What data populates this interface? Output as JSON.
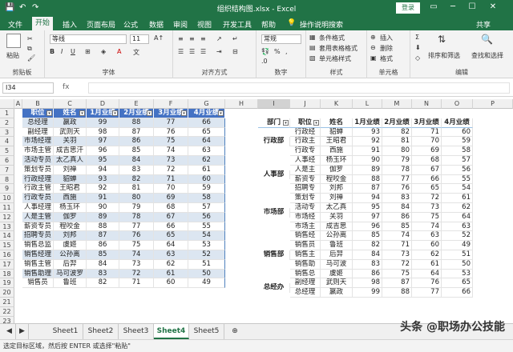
{
  "window": {
    "title": "组织结构图.xlsx - Excel",
    "login_label": "登录"
  },
  "menu": {
    "items": [
      "文件",
      "开始",
      "插入",
      "页面布局",
      "公式",
      "数据",
      "审阅",
      "视图",
      "开发工具",
      "帮助"
    ],
    "tell_me": "操作说明搜索",
    "share": "共享"
  },
  "ribbon": {
    "paste": "粘贴",
    "clipboard": "剪贴板",
    "font_name": "等线",
    "font_size": "11",
    "font": "字体",
    "alignment": "对齐方式",
    "number_format": "常规",
    "number": "数字",
    "cond_format": "条件格式",
    "table_format": "套用表格格式",
    "cell_style": "单元格样式",
    "styles": "样式",
    "insert": "插入",
    "delete": "删除",
    "format": "格式",
    "cells": "单元格",
    "sort_filter": "排序和筛选",
    "find_select": "查找和选择",
    "editing": "编辑"
  },
  "formula": {
    "cell_ref": "I34",
    "fx": "fx"
  },
  "columns": [
    "A",
    "B",
    "C",
    "D",
    "E",
    "F",
    "G",
    "H",
    "I",
    "J",
    "K",
    "L",
    "M",
    "N",
    "O",
    "P"
  ],
  "left_table": {
    "headers": [
      "职位",
      "姓名",
      "1月业绩",
      "2月业绩",
      "3月业绩",
      "4月业绩"
    ],
    "rows": [
      [
        "总经理",
        "嬴政",
        "99",
        "88",
        "77",
        "66"
      ],
      [
        "副经理",
        "武则天",
        "98",
        "87",
        "76",
        "65"
      ],
      [
        "市场经理",
        "关羽",
        "97",
        "86",
        "75",
        "64"
      ],
      [
        "市场主管",
        "成吉思汗",
        "96",
        "85",
        "74",
        "63"
      ],
      [
        "活动专员",
        "太乙真人",
        "95",
        "84",
        "73",
        "62"
      ],
      [
        "策划专员",
        "刘禅",
        "94",
        "83",
        "72",
        "61"
      ],
      [
        "行政经理",
        "貂蝉",
        "93",
        "82",
        "71",
        "60"
      ],
      [
        "行政主管",
        "王昭君",
        "92",
        "81",
        "70",
        "59"
      ],
      [
        "行政专员",
        "西施",
        "91",
        "80",
        "69",
        "58"
      ],
      [
        "人事经理",
        "杨玉环",
        "90",
        "79",
        "68",
        "57"
      ],
      [
        "人是主管",
        "伽罗",
        "89",
        "78",
        "67",
        "56"
      ],
      [
        "薪资专员",
        "程咬金",
        "88",
        "77",
        "66",
        "55"
      ],
      [
        "招聘专员",
        "刘邦",
        "87",
        "76",
        "65",
        "54"
      ],
      [
        "销售总监",
        "虞姬",
        "86",
        "75",
        "64",
        "53"
      ],
      [
        "销售经理",
        "公孙离",
        "85",
        "74",
        "63",
        "52"
      ],
      [
        "销售主管",
        "后羿",
        "84",
        "73",
        "62",
        "51"
      ],
      [
        "销售助理",
        "马可波罗",
        "83",
        "72",
        "61",
        "50"
      ],
      [
        "销售员",
        "鲁班",
        "82",
        "71",
        "60",
        "49"
      ]
    ]
  },
  "pivot": {
    "headers": [
      "部门",
      "职位",
      "姓名",
      "1月业绩",
      "2月业绩",
      "3月业绩",
      "4月业绩"
    ],
    "groups": [
      {
        "dept": "行政部",
        "rows": [
          [
            "行政经",
            "貂蝉",
            "93",
            "82",
            "71",
            "60"
          ],
          [
            "行政主",
            "王昭君",
            "92",
            "81",
            "70",
            "59"
          ],
          [
            "行政专",
            "西施",
            "91",
            "80",
            "69",
            "58"
          ]
        ]
      },
      {
        "dept": "人事部",
        "rows": [
          [
            "人事经",
            "杨玉环",
            "90",
            "79",
            "68",
            "57"
          ],
          [
            "人是主",
            "伽罗",
            "89",
            "78",
            "67",
            "56"
          ],
          [
            "薪资专",
            "程咬金",
            "88",
            "77",
            "66",
            "55"
          ],
          [
            "招聘专",
            "刘邦",
            "87",
            "76",
            "65",
            "54"
          ]
        ]
      },
      {
        "dept": "市场部",
        "rows": [
          [
            "策划专",
            "刘禅",
            "94",
            "83",
            "72",
            "61"
          ],
          [
            "活动专",
            "太乙真",
            "95",
            "84",
            "73",
            "62"
          ],
          [
            "市场经",
            "关羽",
            "97",
            "86",
            "75",
            "64"
          ],
          [
            "市场主",
            "成吉思",
            "96",
            "85",
            "74",
            "63"
          ]
        ]
      },
      {
        "dept": "销售部",
        "rows": [
          [
            "销售经",
            "公孙离",
            "85",
            "74",
            "63",
            "52"
          ],
          [
            "销售员",
            "鲁班",
            "82",
            "71",
            "60",
            "49"
          ],
          [
            "销售主",
            "后羿",
            "84",
            "73",
            "62",
            "51"
          ],
          [
            "销售助",
            "马可波",
            "83",
            "72",
            "61",
            "50"
          ],
          [
            "销售总",
            "虞姬",
            "86",
            "75",
            "64",
            "53"
          ]
        ]
      },
      {
        "dept": "总经办",
        "rows": [
          [
            "副经理",
            "武则天",
            "98",
            "87",
            "76",
            "65"
          ],
          [
            "总经理",
            "嬴政",
            "99",
            "88",
            "77",
            "66"
          ]
        ]
      }
    ]
  },
  "sheets": [
    "Sheet1",
    "Sheet2",
    "Sheet3",
    "Sheet4",
    "Sheet5"
  ],
  "active_sheet": "Sheet4",
  "status": "选定目标区域，然后按 ENTER 或选择\"粘贴\"",
  "watermark": "头条 @职场办公技能",
  "colors": {
    "brand": "#217346",
    "table_header": "#4472c4",
    "band": "#dce6f1"
  }
}
